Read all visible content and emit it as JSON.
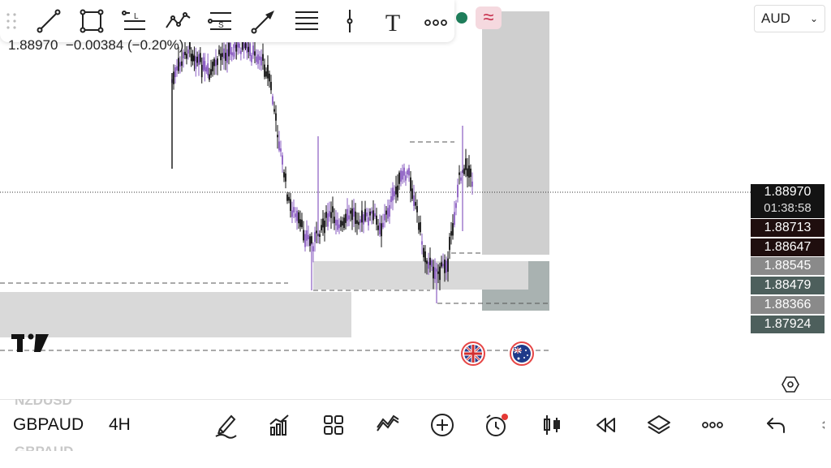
{
  "colors": {
    "accent": "#c8304d",
    "status_dot": "#1e7d5a",
    "bull_candle": "#8a5cc2",
    "bear_candle": "#111111",
    "zone_fill": "#d9d9d9",
    "zone_dark": "#7f9794"
  },
  "toolbar": {
    "tools": [
      {
        "name": "trend-line-icon"
      },
      {
        "name": "rectangle-icon"
      },
      {
        "name": "long-position-icon",
        "label": "L"
      },
      {
        "name": "path-icon"
      },
      {
        "name": "short-position-icon",
        "label": "S"
      },
      {
        "name": "arrow-icon"
      },
      {
        "name": "horizontal-lines-icon"
      },
      {
        "name": "vertical-line-icon"
      },
      {
        "name": "text-icon",
        "label": "T"
      },
      {
        "name": "more-tools-icon"
      }
    ]
  },
  "header": {
    "price_change": "1.88970  −0.00384 (−0.20%)"
  },
  "currency": {
    "selected": "AUD"
  },
  "price_axis": {
    "current": {
      "value": "1.88970",
      "countdown": "01:38:58",
      "bg": "#131313"
    },
    "levels": [
      {
        "value": "1.88713",
        "bg": "#1f0e0e"
      },
      {
        "value": "1.88647",
        "bg": "#1f0e0e"
      },
      {
        "value": "1.88545",
        "bg": "#8a8a8a"
      },
      {
        "value": "1.88479",
        "bg": "#4d5f5c"
      },
      {
        "value": "1.88366",
        "bg": "#8a8a8a"
      },
      {
        "value": "1.87924",
        "bg": "#4d5f5c"
      }
    ]
  },
  "events": [
    {
      "name": "uk-flag-icon"
    },
    {
      "name": "australia-flag-icon"
    }
  ],
  "bottom_bar": {
    "symbol_prev": "NZDUSD",
    "symbol": "GBPAUD",
    "symbol_next": "GBPAUD",
    "interval": "4H",
    "buttons": [
      {
        "name": "drawing-tools-icon"
      },
      {
        "name": "indicators-icon"
      },
      {
        "name": "layouts-icon"
      },
      {
        "name": "compare-icon"
      },
      {
        "name": "add-icon"
      },
      {
        "name": "alert-icon"
      },
      {
        "name": "chart-type-icon"
      },
      {
        "name": "replay-icon"
      },
      {
        "name": "layers-icon"
      },
      {
        "name": "more-icon"
      },
      {
        "name": "undo-icon"
      }
    ]
  }
}
